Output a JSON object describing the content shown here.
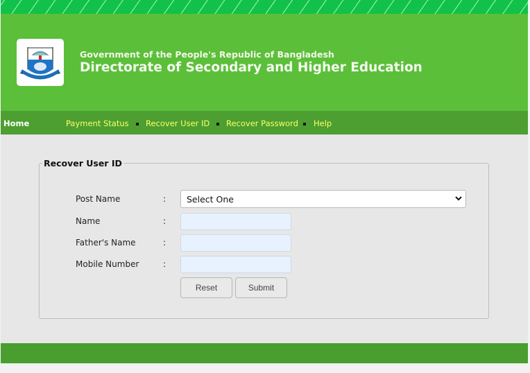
{
  "header": {
    "subtitle": "Government of the People's Republic of Bangladesh",
    "title": "Directorate of Secondary and Higher Education",
    "logo": "dshe-emblem-logo"
  },
  "nav": {
    "home": "Home",
    "items": [
      {
        "label": "Payment Status"
      },
      {
        "label": "Recover User ID"
      },
      {
        "label": "Recover Password"
      },
      {
        "label": "Help"
      }
    ]
  },
  "form": {
    "legend": "Recover User ID",
    "separator": ":",
    "fields": [
      {
        "label": "Post Name",
        "type": "select",
        "value": "Select One"
      },
      {
        "label": "Name",
        "type": "text",
        "value": ""
      },
      {
        "label": "Father's Name",
        "type": "text",
        "value": ""
      },
      {
        "label": "Mobile Number",
        "type": "text",
        "value": ""
      }
    ],
    "buttons": {
      "reset": "Reset",
      "submit": "Submit"
    }
  },
  "colors": {
    "header_green": "#5cbf3a",
    "nav_green": "#4c9f30",
    "nav_link": "#ffff66",
    "stripe_green": "#12c14a",
    "footer_green": "#4a9e30",
    "content_bg": "#e7e7e7",
    "input_bg": "#e8f2fe"
  }
}
